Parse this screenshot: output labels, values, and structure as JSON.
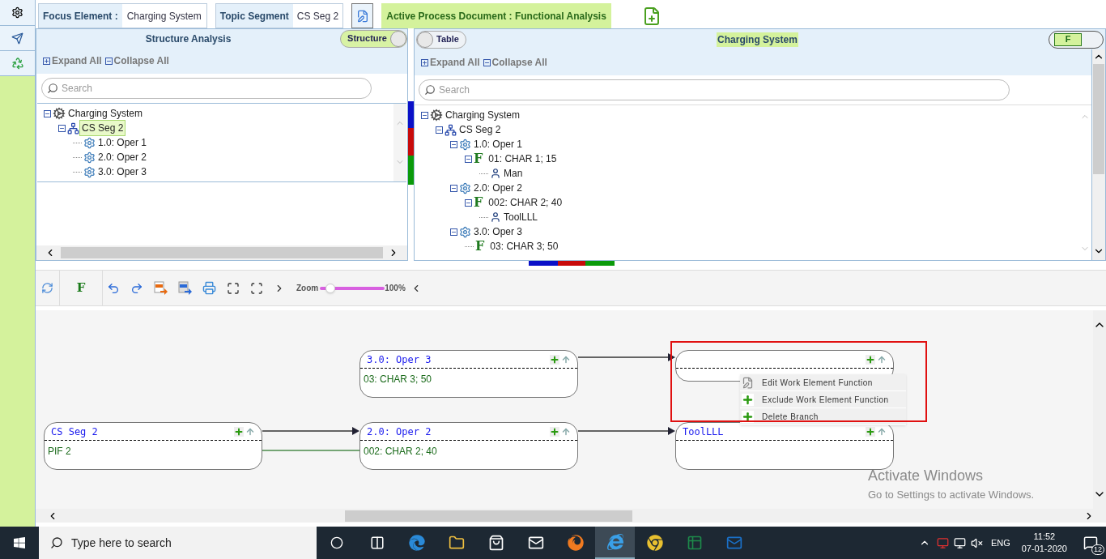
{
  "topbar": {
    "focus_label": "Focus Element :",
    "focus_value": "Charging System",
    "topic_label": "Topic Segment",
    "topic_value": "CS Seg 2",
    "document": "Active Process Document : Functional Analysis"
  },
  "structure_panel": {
    "title": "Structure Analysis",
    "toggle": {
      "label": "Structure",
      "on": true
    },
    "expand_all": "Expand All",
    "collapse_all": "Collapse All",
    "search": {
      "placeholder": "Search"
    },
    "tree": [
      {
        "label": "Charging System",
        "kind": "system",
        "selected": false,
        "expanded": true,
        "children": [
          {
            "label": "CS Seg 2",
            "kind": "segment",
            "selected": true,
            "expanded": true,
            "children": [
              {
                "label": "1.0: Oper 1",
                "kind": "operation",
                "selected": false
              },
              {
                "label": "2.0: Oper 2",
                "kind": "operation",
                "selected": false
              },
              {
                "label": "3.0: Oper 3",
                "kind": "operation",
                "selected": false
              }
            ]
          }
        ]
      }
    ]
  },
  "function_panel": {
    "toggle": {
      "label": "Table",
      "on": false
    },
    "title": "Charging System",
    "mode_toggle": {
      "label": "F",
      "on": true
    },
    "expand_all": "Expand All",
    "collapse_all": "Collapse All",
    "search": {
      "placeholder": "Search"
    },
    "tree": [
      {
        "label": "Charging System",
        "kind": "system",
        "expanded": true,
        "children": [
          {
            "label": "CS Seg 2",
            "kind": "segment",
            "expanded": true,
            "children": [
              {
                "label": "1.0: Oper 1",
                "kind": "operation",
                "expanded": true,
                "children": [
                  {
                    "label": "01: CHAR 1; 15",
                    "kind": "function",
                    "marker": "F",
                    "expanded": true,
                    "children": [
                      {
                        "label": "Man",
                        "kind": "work-element"
                      }
                    ]
                  }
                ]
              },
              {
                "label": "2.0: Oper 2",
                "kind": "operation",
                "expanded": true,
                "children": [
                  {
                    "label": "002: CHAR 2; 40",
                    "kind": "function",
                    "marker": "F",
                    "expanded": true,
                    "children": [
                      {
                        "label": "ToolLLL",
                        "kind": "work-element"
                      }
                    ]
                  }
                ]
              },
              {
                "label": "3.0: Oper 3",
                "kind": "operation",
                "expanded": true,
                "children": [
                  {
                    "label": "03: CHAR 3; 50",
                    "kind": "function",
                    "marker": "F"
                  }
                ]
              }
            ]
          }
        ]
      }
    ]
  },
  "toolbar": {
    "mode": "F",
    "zoom_label": "Zoom",
    "zoom": {
      "level": 0.08
    },
    "zoom_reading": "100%"
  },
  "diagram": {
    "nodes": [
      {
        "kind": "titled",
        "title": "CS Seg 2",
        "body": "PIF 2"
      },
      {
        "kind": "titled",
        "title": "3.0: Oper 3",
        "body": "03: CHAR 3; 50"
      },
      {
        "kind": "titled",
        "title": "2.0: Oper 2",
        "body": "002: CHAR 2; 40"
      },
      {
        "kind": "blank"
      },
      {
        "kind": "titled",
        "title": "ToolLLL"
      }
    ],
    "context_menu": [
      {
        "label": "Edit Work Element Function",
        "kind": "edit"
      },
      {
        "label": "Exclude Work Element Function",
        "kind": "add"
      },
      {
        "label": "Delete Branch",
        "kind": "add"
      }
    ],
    "notice": {
      "title": "Activate Windows",
      "text": "Go to Settings to activate Windows."
    }
  },
  "taskbar": {
    "search": {
      "placeholder": "Type here to search"
    },
    "apps": [
      {
        "kind": "taskview",
        "selected": false
      },
      {
        "kind": "edge",
        "selected": false
      },
      {
        "kind": "folder",
        "selected": false
      },
      {
        "kind": "store",
        "selected": false
      },
      {
        "kind": "mail",
        "selected": false
      },
      {
        "kind": "firefox",
        "selected": false
      },
      {
        "kind": "ie",
        "selected": true
      },
      {
        "kind": "chrome",
        "selected": false
      },
      {
        "kind": "excel",
        "selected": false
      },
      {
        "kind": "outlook",
        "selected": false
      }
    ],
    "language": "ENG",
    "time": "11:52",
    "date": "07-01-2020",
    "notifications": "12"
  }
}
